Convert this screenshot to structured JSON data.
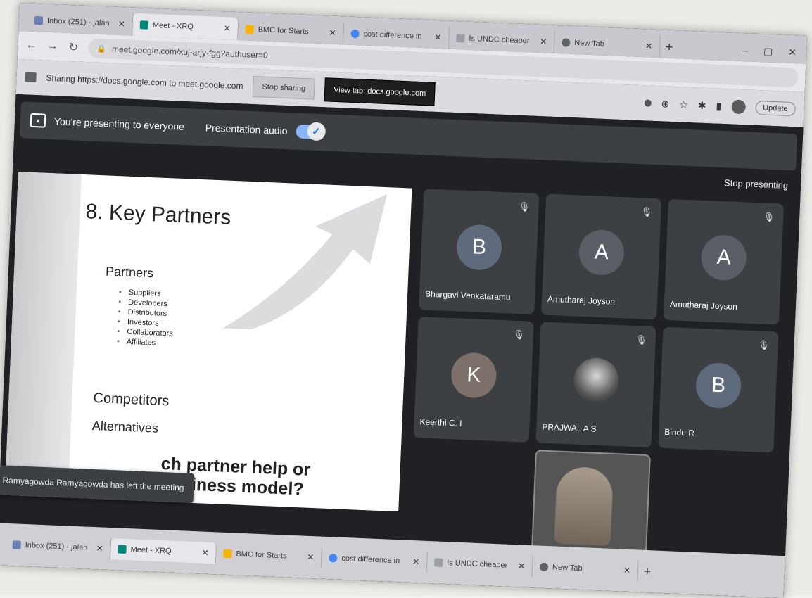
{
  "tabs": [
    {
      "label": "Inbox (251) - jalan",
      "active": false
    },
    {
      "label": "Meet - XRQ",
      "active": true
    },
    {
      "label": "BMC for Starts",
      "active": false
    },
    {
      "label": "cost difference in",
      "active": false
    },
    {
      "label": "Is UNDC cheaper",
      "active": false
    },
    {
      "label": "New Tab",
      "active": false
    }
  ],
  "window_controls": {
    "minimize": "–",
    "restore": "▢",
    "close": "✕"
  },
  "address": {
    "url": "meet.google.com/xuj-arjy-fgg?authuser=0"
  },
  "sharebar": {
    "text": "Sharing https://docs.google.com to meet.google.com",
    "stop_sharing": "Stop sharing",
    "view_tab": "View tab: docs.google.com",
    "update": "Update"
  },
  "presenting": {
    "message": "You're presenting to everyone",
    "audio_label": "Presentation audio",
    "stop_label": "Stop presenting"
  },
  "slide": {
    "title": "8. Key Partners",
    "partners_heading": "Partners",
    "items": [
      "Suppliers",
      "Developers",
      "Distributors",
      "Investors",
      "Collaborators",
      "Affiliates"
    ],
    "competitors": "Competitors",
    "alternatives": "Alternatives",
    "question_line1": "ch partner help or",
    "question_line2": "business model?"
  },
  "toast": {
    "message": "Ramyagowda Ramyagowda has left the meeting"
  },
  "participants": [
    {
      "initial": "B",
      "name": "Bhargavi Venkataramu"
    },
    {
      "initial": "A",
      "name": "Amutharaj Joyson"
    },
    {
      "initial": "A",
      "name": "Amutharaj Joyson"
    },
    {
      "initial": "K",
      "name": "Keerthi C. I"
    },
    {
      "initial": "",
      "name": "PRAJWAL A S"
    },
    {
      "initial": "B",
      "name": "Bindu R"
    }
  ],
  "colors": {
    "meet_bg": "#202124",
    "tile_bg": "#3c4043",
    "accent": "#8ab4f8"
  }
}
